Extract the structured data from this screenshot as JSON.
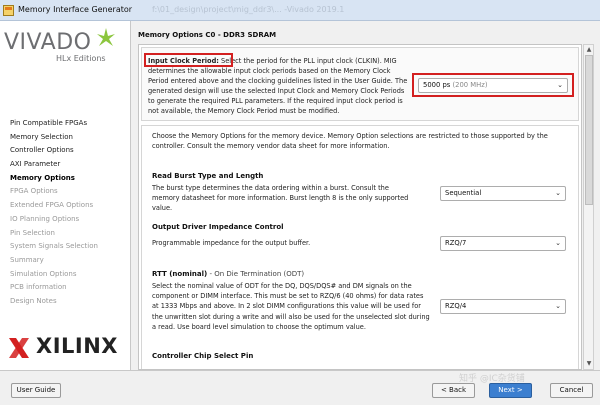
{
  "window": {
    "title": "Memory Interface Generator",
    "ghost_path": "f:\\01_design\\project\\mig_ddr3\\...  -Vivado 2019.1"
  },
  "brand": {
    "vivado": "VIVADO",
    "hlx": "HLx Editions",
    "xilinx": "XILINX",
    "vivado_color": "#6d6e71",
    "leaf_color": "#8cc63e",
    "xilinx_logo_color": "#d32020"
  },
  "sidebar": {
    "steps": [
      {
        "label": "Pin Compatible FPGAs",
        "state": "done"
      },
      {
        "label": "Memory Selection",
        "state": "done"
      },
      {
        "label": "Controller Options",
        "state": "done"
      },
      {
        "label": "AXI Parameter",
        "state": "done"
      },
      {
        "label": "Memory Options",
        "state": "current"
      },
      {
        "label": "FPGA Options",
        "state": "disabled"
      },
      {
        "label": "Extended FPGA Options",
        "state": "disabled"
      },
      {
        "label": "IO Planning Options",
        "state": "disabled"
      },
      {
        "label": "Pin Selection",
        "state": "disabled"
      },
      {
        "label": "System Signals Selection",
        "state": "disabled"
      },
      {
        "label": "Summary",
        "state": "disabled"
      },
      {
        "label": "Simulation Options",
        "state": "disabled"
      },
      {
        "label": "PCB information",
        "state": "disabled"
      },
      {
        "label": "Design Notes",
        "state": "disabled"
      }
    ]
  },
  "main": {
    "title": "Memory Options C0 - DDR3 SDRAM",
    "input_clock": {
      "label": "Input Clock Period:",
      "description": " Select the period for the PLL input clock (CLKIN). MIG determines the allowable input clock periods based on the Memory Clock Period entered above and the clocking guidelines listed in the User Guide. The generated design will use the selected Input Clock and Memory Clock Periods to generate the required PLL parameters. If the required input clock period is not available, the Memory Clock Period must be modified.",
      "value": "5000 ps",
      "value_hint": "(200 MHz)"
    },
    "intro": "Choose the Memory Options for the memory device. Memory Option selections are restricted to those supported by the controller. Consult the memory vendor data sheet for more information.",
    "burst": {
      "heading": "Read Burst Type and Length",
      "description": "The burst type determines the data ordering within a burst. Consult the memory datasheet for more information. Burst length 8 is the only supported value.",
      "value": "Sequential"
    },
    "odi": {
      "heading": "Output Driver Impedance Control",
      "description": "Programmable impedance for the output buffer.",
      "value": "RZQ/7"
    },
    "rtt": {
      "heading": "RTT (nominal)",
      "heading_sub": " - On Die Termination (ODT)",
      "description": "Select the nominal value of ODT for the DQ, DQS/DQS# and DM signals on the component or DIMM interface. This must be set to RZQ/6 (40 ohms) for data rates at 1333 Mbps and above. In 2 slot DIMM configurations this value will be used for the unwritten slot during a write and will also be used for the unselected slot during a read. Use board level simulation to choose the optimum value.",
      "value": "RZQ/4"
    },
    "cs": {
      "heading": "Controller Chip Select Pin"
    }
  },
  "footer": {
    "user_guide": "User Guide",
    "back": "< Back",
    "next": "Next >",
    "cancel": "Cancel",
    "watermark": "知乎 @IC杂货铺"
  }
}
